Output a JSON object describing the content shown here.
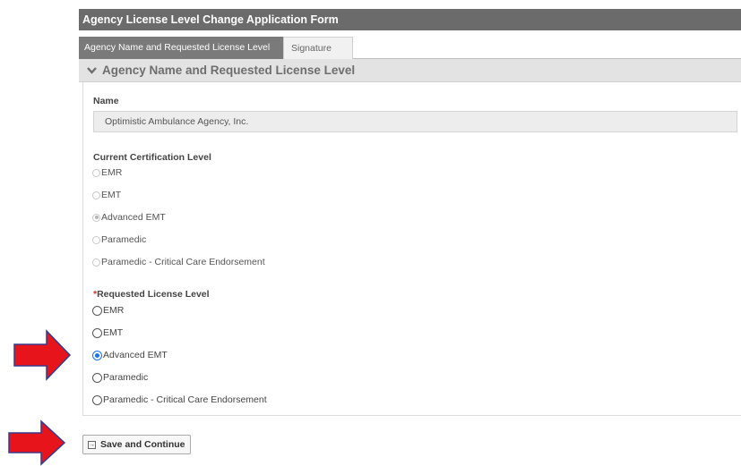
{
  "form": {
    "title": "Agency License Level Change Application Form",
    "tabs": [
      {
        "label": "Agency Name and Requested License Level",
        "active": true
      },
      {
        "label": "Signature",
        "active": false
      }
    ],
    "section_title": "Agency Name and Requested License Level"
  },
  "name_field": {
    "label": "Name",
    "value": "Optimistic Ambulance Agency, Inc."
  },
  "current_level": {
    "label": "Current Certification Level",
    "options": [
      "EMR",
      "EMT",
      "Advanced EMT",
      "Paramedic",
      "Paramedic - Critical Care Endorsement"
    ],
    "selected": "Advanced EMT"
  },
  "requested_level": {
    "required_mark": "*",
    "label": "Requested License Level",
    "options": [
      "EMR",
      "EMT",
      "Advanced EMT",
      "Paramedic",
      "Paramedic - Critical Care Endorsement"
    ],
    "selected": "Advanced EMT"
  },
  "save_button": {
    "label": "Save and Continue",
    "icon": "arrow-into-box-icon"
  },
  "colors": {
    "title_bar": "#6b6b6b",
    "annotation_arrow": "#e8141b",
    "radio_selected": "#1a73e8"
  }
}
